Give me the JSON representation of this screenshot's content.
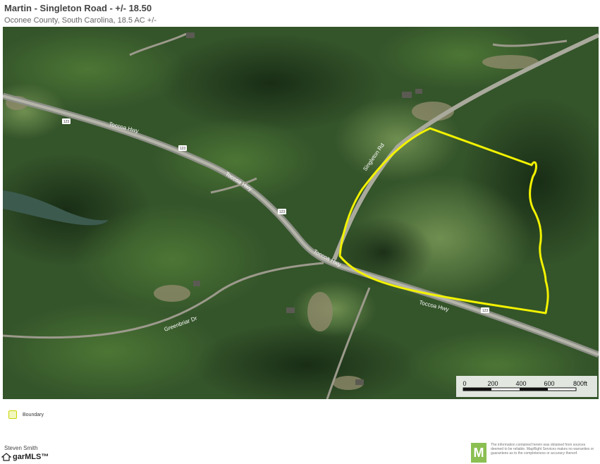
{
  "header": {
    "title": "Martin - Singleton Road - +/- 18.50",
    "subtitle": "Oconee County, South Carolina, 18.5 AC +/-"
  },
  "map": {
    "road_labels": [
      "Toccoa Hwy",
      "Toccoa Hwy",
      "Toccoa Hwy",
      "Toccoa Hwy",
      "Singleton Rd",
      "Greenbriar Dr"
    ],
    "route_shields": [
      "123",
      "123",
      "123",
      "123"
    ],
    "scale_bar": {
      "ticks": [
        "0",
        "200",
        "400",
        "600",
        "800ft"
      ]
    },
    "boundary_color": "#f2f200"
  },
  "legend": {
    "label": "Boundary"
  },
  "footer": {
    "agent_name": "Steven Smith",
    "mls_brand": "garMLS™",
    "disclaimer_badge": "M",
    "disclaimer": "The information contained herein was obtained from sources deemed to be reliable. MapRight Services makes no warranties or guarantees as to the completeness or accuracy thereof."
  }
}
